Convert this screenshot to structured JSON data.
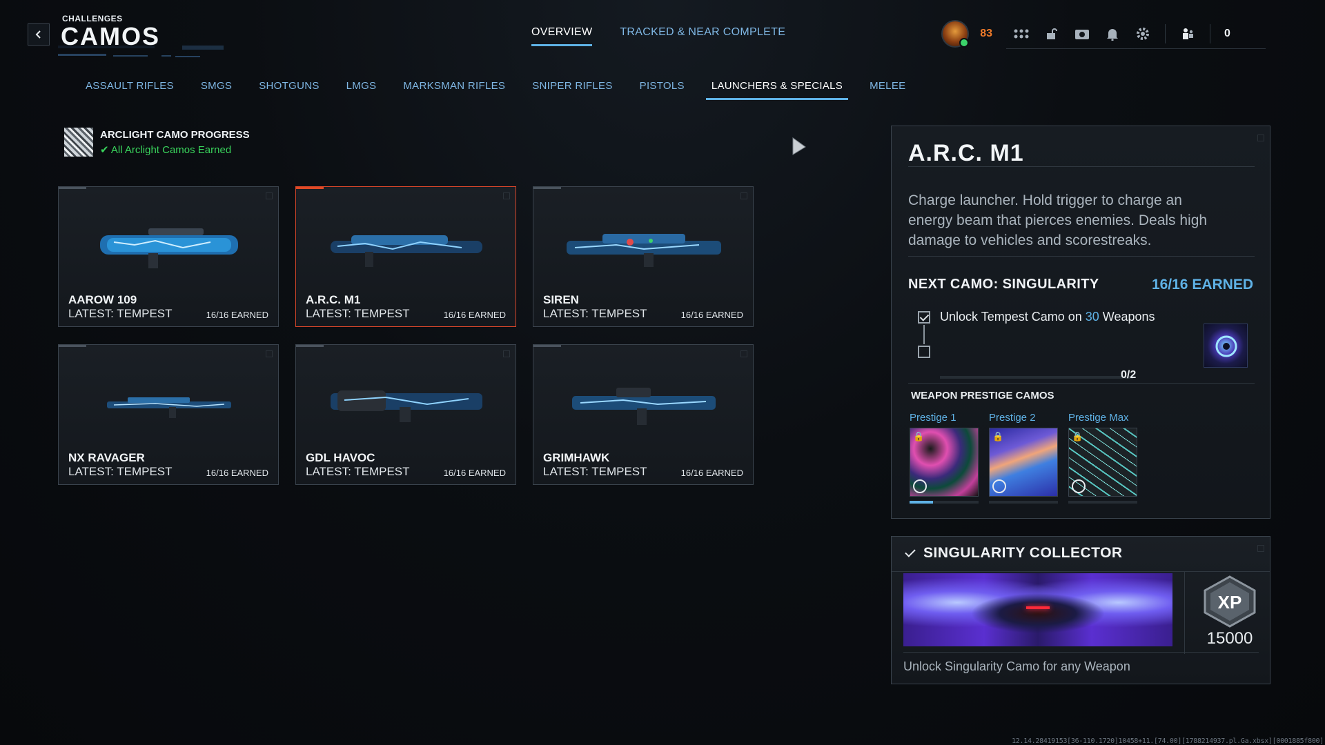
{
  "header": {
    "kicker": "CHALLENGES",
    "title": "CAMOS",
    "level": "83",
    "currency": "0",
    "icons": [
      "grid-icon",
      "unlock-icon",
      "camera-icon",
      "bell-icon",
      "gear-icon",
      "squad-icon"
    ]
  },
  "top_tabs": [
    {
      "label": "OVERVIEW",
      "active": true
    },
    {
      "label": "TRACKED & NEAR COMPLETE",
      "active": false
    }
  ],
  "sub_tabs": [
    {
      "label": "ASSAULT RIFLES"
    },
    {
      "label": "SMGS"
    },
    {
      "label": "SHOTGUNS"
    },
    {
      "label": "LMGS"
    },
    {
      "label": "MARKSMAN RIFLES"
    },
    {
      "label": "SNIPER RIFLES"
    },
    {
      "label": "PISTOLS"
    },
    {
      "label": "LAUNCHERS & SPECIALS",
      "active": true
    },
    {
      "label": "MELEE"
    }
  ],
  "arclight": {
    "title": "ARCLIGHT CAMO PROGRESS",
    "status": "All Arclight Camos Earned"
  },
  "weapons": [
    {
      "name": "AAROW 109",
      "latest": "LATEST: TEMPEST",
      "earned": "16/16 EARNED",
      "selected": false
    },
    {
      "name": "A.R.C. M1",
      "latest": "LATEST: TEMPEST",
      "earned": "16/16 EARNED",
      "selected": true
    },
    {
      "name": "SIREN",
      "latest": "LATEST: TEMPEST",
      "earned": "16/16 EARNED",
      "selected": false
    },
    {
      "name": "NX RAVAGER",
      "latest": "LATEST: TEMPEST",
      "earned": "16/16 EARNED",
      "selected": false
    },
    {
      "name": "GDL HAVOC",
      "latest": "LATEST: TEMPEST",
      "earned": "16/16 EARNED",
      "selected": false
    },
    {
      "name": "GRIMHAWK",
      "latest": "LATEST: TEMPEST",
      "earned": "16/16 EARNED",
      "selected": false
    }
  ],
  "detail": {
    "title": "A.R.C. M1",
    "description": "Charge launcher. Hold trigger to charge an energy beam that pierces enemies. Deals high damage to vehicles and scorestreaks.",
    "next_camo": "NEXT CAMO: SINGULARITY",
    "earned": "16/16 EARNED",
    "task_prefix": "Unlock Tempest Camo on ",
    "task_number": "30",
    "task_suffix": " Weapons",
    "progress": "0/2",
    "progress_fraction": 0,
    "prestige_header": "WEAPON PRESTIGE CAMOS",
    "prestige": [
      {
        "label": "Prestige 1"
      },
      {
        "label": "Prestige 2"
      },
      {
        "label": "Prestige Max"
      }
    ]
  },
  "collector": {
    "title": "SINGULARITY COLLECTOR",
    "xp_label": "XP",
    "xp_value": "15000",
    "description": "Unlock Singularity Camo for any Weapon"
  },
  "footer_id": "12.14.28419153[36-110.1720]10458+11.[74.00][1788214937.pl.Ga.xbsx][0001885f800]",
  "colors": {
    "accent_blue": "#5fb2e6",
    "selected_border": "#d8462a",
    "level_orange": "#f07b2a",
    "status_green": "#39d45c"
  }
}
